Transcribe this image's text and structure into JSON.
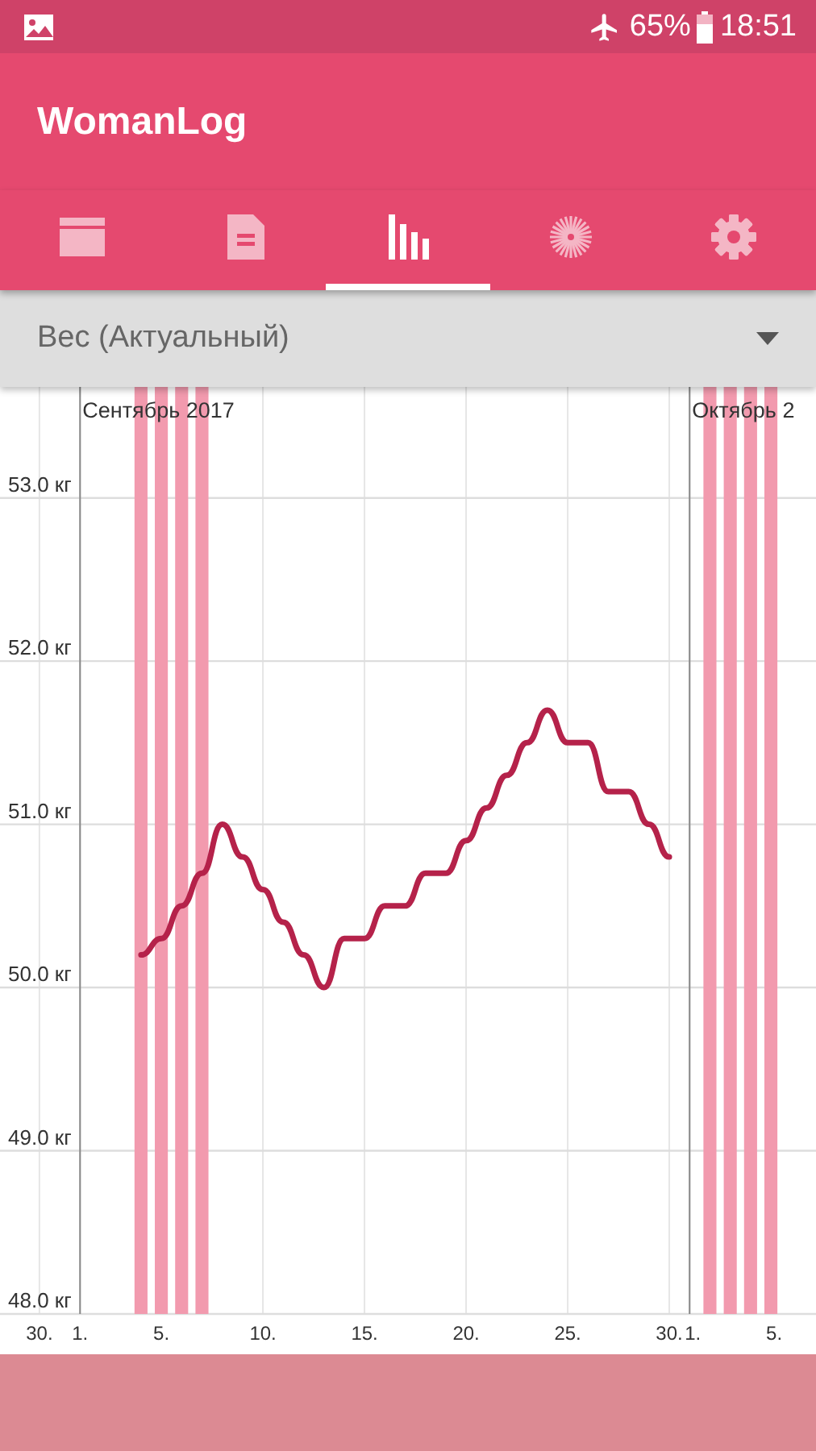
{
  "status_bar": {
    "battery_percent": "65%",
    "time": "18:51"
  },
  "app_bar": {
    "title": "WomanLog"
  },
  "tabs": [
    {
      "kind": "calendar",
      "selected": false
    },
    {
      "kind": "notes",
      "selected": false
    },
    {
      "kind": "charts",
      "selected": true
    },
    {
      "kind": "flower",
      "selected": false
    },
    {
      "kind": "settings",
      "selected": false
    }
  ],
  "dropdown": {
    "value": "Вес (Актуальный)"
  },
  "chart": {
    "chart_data": {
      "type": "line",
      "grid": true,
      "ylim": [
        48,
        53.68
      ],
      "xlim": [
        -2.94,
        37.22
      ],
      "yticks": [
        {
          "value": 48,
          "label": "48.0 кг"
        },
        {
          "value": 49,
          "label": "49.0 кг"
        },
        {
          "value": 50,
          "label": "50.0 кг"
        },
        {
          "value": 51,
          "label": "51.0 кг"
        },
        {
          "value": 52,
          "label": "52.0 кг"
        },
        {
          "value": 53,
          "label": "53.0 кг"
        }
      ],
      "xticks": [
        {
          "value": 1,
          "label": "1."
        },
        {
          "value": 5,
          "label": "5."
        },
        {
          "value": 10,
          "label": "10."
        },
        {
          "value": 15,
          "label": "15."
        },
        {
          "value": 20,
          "label": "20."
        },
        {
          "value": 25,
          "label": "25."
        },
        {
          "value": 30,
          "label": "30."
        }
      ],
      "x": [
        4,
        5,
        6,
        7,
        8,
        9,
        10,
        11,
        12,
        13,
        14,
        15,
        16,
        17,
        18,
        19,
        20,
        21,
        22,
        23,
        24,
        25,
        26,
        27,
        28,
        29,
        30
      ],
      "series": [
        {
          "color": "#b5224a",
          "values": [
            50.2,
            50.3,
            50.5,
            50.7,
            51.0,
            50.8,
            50.6,
            50.4,
            50.2,
            50.0,
            50.3,
            50.3,
            50.5,
            50.5,
            50.7,
            50.7,
            50.9,
            51.1,
            51.3,
            51.5,
            51.7,
            51.5,
            51.5,
            51.2,
            51.2,
            51.0,
            50.8
          ]
        }
      ],
      "ref_lines": [
        {
          "axis": "x",
          "value": 1
        },
        {
          "axis": "x",
          "value": 31
        }
      ],
      "bands": [
        {
          "axis": "x",
          "from": 3.68,
          "to": 4.32
        },
        {
          "axis": "x",
          "from": 4.68,
          "to": 5.32
        },
        {
          "axis": "x",
          "from": 5.68,
          "to": 6.32
        },
        {
          "axis": "x",
          "from": 6.68,
          "to": 7.32
        },
        {
          "axis": "x",
          "from": 31.68,
          "to": 32.32
        },
        {
          "axis": "x",
          "from": 32.68,
          "to": 33.32
        },
        {
          "axis": "x",
          "from": 33.68,
          "to": 34.32
        },
        {
          "axis": "x",
          "from": 34.68,
          "to": 35.32
        }
      ],
      "annotations": [
        "Сентябрь 2017",
        "Октябрь 2"
      ]
    },
    "prev_month_day_labels": [
      "30."
    ],
    "next_month_day_labels": [
      "1.",
      "5."
    ]
  }
}
